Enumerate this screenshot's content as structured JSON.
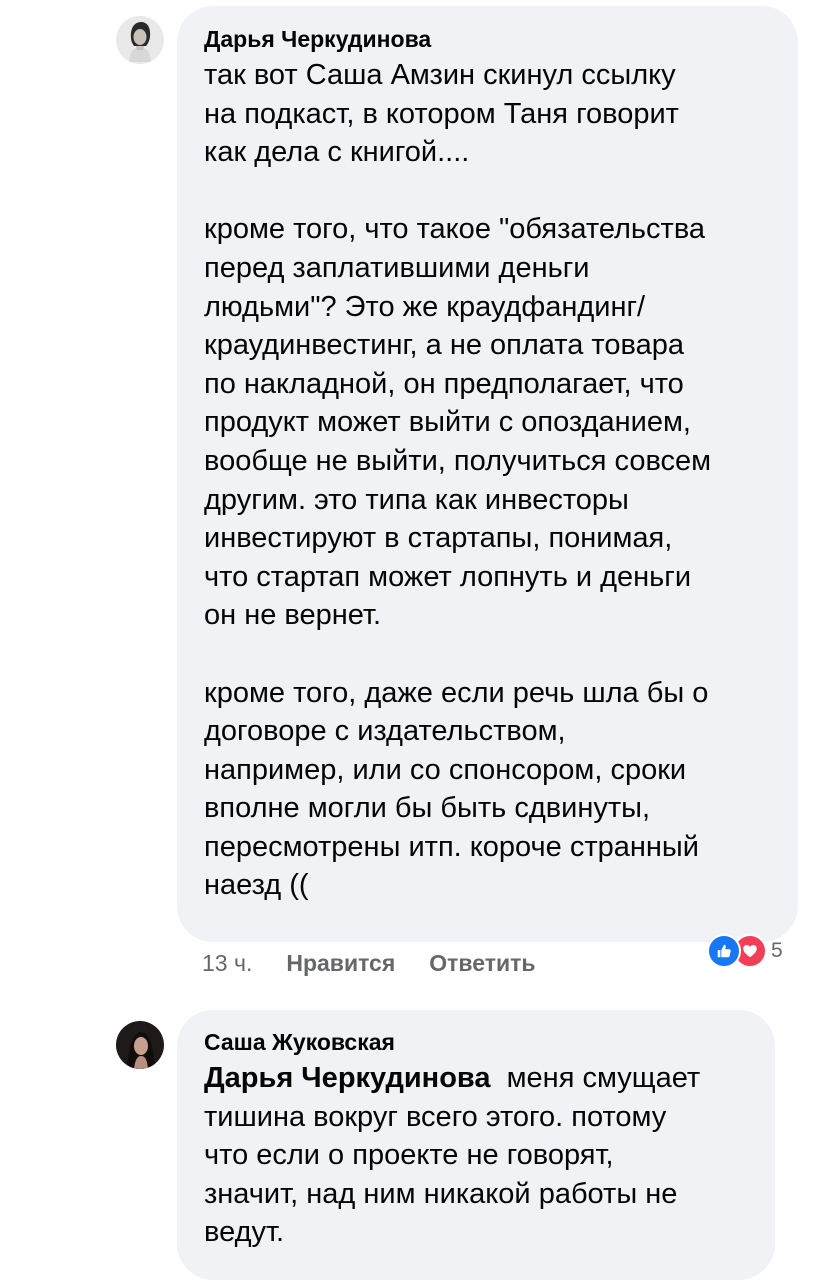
{
  "comments": [
    {
      "author": "Дарья Черкудинова",
      "text": "так вот Саша Амзин скинул ссылку\nна подкаст, в котором Таня говорит\nкак дела с книгой....\n\nкроме того, что такое \"обязательства\nперед заплатившими деньги\nлюдьми\"? Это же краудфандинг/\nкраудинвестинг, а не оплата товара\nпо накладной, он предполагает, что\nпродукт может выйти с опозданием,\nвообще не выйти, получиться совсем\nдругим. это типа как инвесторы\nинвестируют в стартапы, понимая,\nчто стартап может лопнуть и деньги\nон не вернет.\n\nкроме того, даже если речь шла бы о\nдоговоре с издательством,\nнапример, или со спонсором, сроки\nвполне могли бы быть сдвинуты,\nпересмотрены итп. короче странный\nнаезд ((",
      "time": "13 ч.",
      "like_label": "Нравится",
      "reply_label": "Ответить",
      "reactions": {
        "icons": [
          "like-icon",
          "love-icon"
        ],
        "count": "5",
        "like_color": "#1877f2",
        "love_color": "#f33e58"
      }
    },
    {
      "author": "Саша Жуковская",
      "mention": "Дарья Черкудинова",
      "text": "  меня смущает\nтишина вокруг всего этого. потому\nчто если о проекте не говорят,\nзначит, над ним никакой работы не\nведут."
    }
  ],
  "colors": {
    "bubble": "#f0f2f5",
    "text": "#050505",
    "secondary": "#65676b"
  }
}
